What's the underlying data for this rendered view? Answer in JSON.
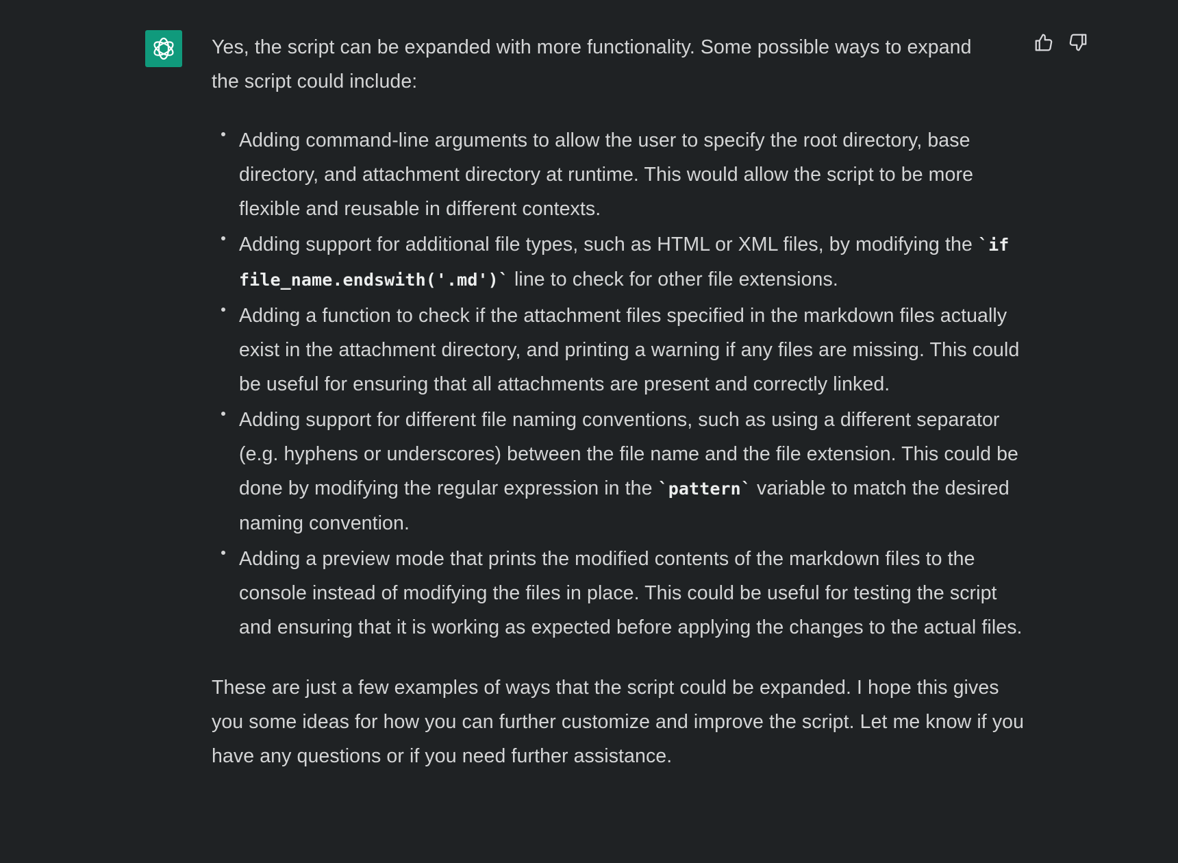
{
  "message": {
    "avatar_icon": "openai-logo-icon",
    "intro": "Yes, the script can be expanded with more functionality. Some possible ways to expand the script could include:",
    "items": [
      {
        "before": "Adding command-line arguments to allow the user to specify the root directory, base directory, and attachment directory at runtime. This would allow the script to be more flexible and reusable in different contexts.",
        "code": "",
        "after": ""
      },
      {
        "before": "Adding support for additional file types, such as HTML or XML files, by modifying the ",
        "code": "`if file_name.endswith('.md')`",
        "after": " line to check for other file extensions."
      },
      {
        "before": "Adding a function to check if the attachment files specified in the markdown files actually exist in the attachment directory, and printing a warning if any files are missing. This could be useful for ensuring that all attachments are present and correctly linked.",
        "code": "",
        "after": ""
      },
      {
        "before": "Adding support for different file naming conventions, such as using a different separator (e.g. hyphens or underscores) between the file name and the file extension. This could be done by modifying the regular expression in the ",
        "code": "`pattern`",
        "after": " variable to match the desired naming convention."
      },
      {
        "before": "Adding a preview mode that prints the modified contents of the markdown files to the console instead of modifying the files in place. This could be useful for testing the script and ensuring that it is working as expected before applying the changes to the actual files.",
        "code": "",
        "after": ""
      }
    ],
    "outro": "These are just a few examples of ways that the script could be expanded. I hope this gives you some ideas for how you can further customize and improve the script. Let me know if you have any questions or if you need further assistance."
  },
  "feedback": {
    "thumbs_up_icon": "thumbs-up-icon",
    "thumbs_down_icon": "thumbs-down-icon"
  },
  "colors": {
    "background": "#1f2224",
    "text": "#d4d5d6",
    "avatar": "#109a7c"
  }
}
